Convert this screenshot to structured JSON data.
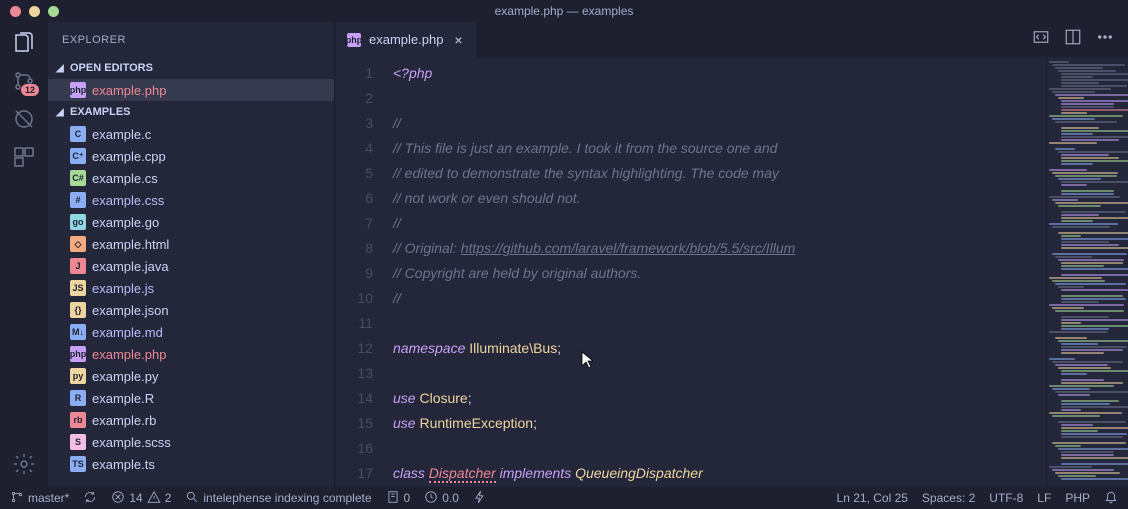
{
  "window": {
    "title": "example.php — examples"
  },
  "sidebar": {
    "title": "EXPLORER",
    "sections": {
      "open_editors": {
        "label": "OPEN EDITORS"
      },
      "examples": {
        "label": "EXAMPLES"
      }
    },
    "open_file": {
      "name": "example.php",
      "kind": "php"
    },
    "files": [
      {
        "name": "example.c",
        "kind": "c"
      },
      {
        "name": "example.cpp",
        "kind": "cpp"
      },
      {
        "name": "example.cs",
        "kind": "cs"
      },
      {
        "name": "example.css",
        "kind": "css"
      },
      {
        "name": "example.go",
        "kind": "go"
      },
      {
        "name": "example.html",
        "kind": "html"
      },
      {
        "name": "example.java",
        "kind": "java"
      },
      {
        "name": "example.js",
        "kind": "js"
      },
      {
        "name": "example.json",
        "kind": "json"
      },
      {
        "name": "example.md",
        "kind": "md"
      },
      {
        "name": "example.php",
        "kind": "php"
      },
      {
        "name": "example.py",
        "kind": "py"
      },
      {
        "name": "example.R",
        "kind": "r"
      },
      {
        "name": "example.rb",
        "kind": "rb"
      },
      {
        "name": "example.scss",
        "kind": "scss"
      },
      {
        "name": "example.ts",
        "kind": "ts"
      }
    ]
  },
  "activity": {
    "scm_badge": "12"
  },
  "tabs": {
    "active": {
      "name": "example.php",
      "kind": "php"
    }
  },
  "code": {
    "lines": [
      {
        "n": 1,
        "raw": "<?php",
        "kind": "keyword"
      },
      {
        "n": 2,
        "raw": "",
        "kind": "blank"
      },
      {
        "n": 3,
        "raw": "//",
        "kind": "comment"
      },
      {
        "n": 4,
        "raw": "// This file is just an example. I took it from the source one and",
        "kind": "comment"
      },
      {
        "n": 5,
        "raw": "// edited to demonstrate the syntax highlighting. The code may",
        "kind": "comment"
      },
      {
        "n": 6,
        "raw": "// not work or even should not.",
        "kind": "comment"
      },
      {
        "n": 7,
        "raw": "//",
        "kind": "comment"
      },
      {
        "n": 8,
        "raw": "// Original: https://github.com/laravel/framework/blob/5.5/src/Illum",
        "kind": "comment-url",
        "prefix": "// Original: ",
        "url": "https://github.com/laravel/framework/blob/5.5/src/Illum"
      },
      {
        "n": 9,
        "raw": "// Copyright are held by original authors.",
        "kind": "comment"
      },
      {
        "n": 10,
        "raw": "//",
        "kind": "comment"
      },
      {
        "n": 11,
        "raw": "",
        "kind": "blank"
      },
      {
        "n": 12,
        "raw": "namespace Illuminate\\Bus;",
        "kind": "ns",
        "kw": "namespace",
        "ns": "Illuminate\\Bus"
      },
      {
        "n": 13,
        "raw": "",
        "kind": "blank"
      },
      {
        "n": 14,
        "raw": "use Closure;",
        "kind": "use",
        "kw": "use",
        "cls": "Closure"
      },
      {
        "n": 15,
        "raw": "use RuntimeException;",
        "kind": "use",
        "kw": "use",
        "cls": "RuntimeException"
      },
      {
        "n": 16,
        "raw": "",
        "kind": "blank"
      },
      {
        "n": 17,
        "raw": "class Dispatcher implements QueueingDispatcher",
        "kind": "class",
        "kw1": "class",
        "name": "Dispatcher",
        "kw2": "implements",
        "iface": "QueueingDispatcher"
      }
    ]
  },
  "statusbar": {
    "branch": "master*",
    "errors": "14",
    "warnings": "2",
    "message": "intelephense indexing complete",
    "notebook": "0",
    "timer": "0.0",
    "position": "Ln 21, Col 25",
    "spaces": "Spaces: 2",
    "encoding": "UTF-8",
    "eol": "LF",
    "language": "PHP"
  },
  "icons": {
    "c": {
      "txt": "C",
      "bg": "#8aadf4",
      "fg": "#1e2030"
    },
    "cpp": {
      "txt": "C⁺",
      "bg": "#8aadf4",
      "fg": "#1e2030"
    },
    "cs": {
      "txt": "C#",
      "bg": "#a6da95",
      "fg": "#1e2030"
    },
    "css": {
      "txt": "#",
      "bg": "#8aadf4",
      "fg": "#1e2030"
    },
    "go": {
      "txt": "go",
      "bg": "#91d7e3",
      "fg": "#1e2030"
    },
    "html": {
      "txt": "◇",
      "bg": "#f5a97f",
      "fg": "#1e2030"
    },
    "java": {
      "txt": "J",
      "bg": "#ed8796",
      "fg": "#1e2030"
    },
    "js": {
      "txt": "JS",
      "bg": "#eed49f",
      "fg": "#1e2030"
    },
    "json": {
      "txt": "{}",
      "bg": "#eed49f",
      "fg": "#1e2030"
    },
    "md": {
      "txt": "M↓",
      "bg": "#8aadf4",
      "fg": "#1e2030"
    },
    "php": {
      "txt": "php",
      "bg": "#c6a0f6",
      "fg": "#1e2030"
    },
    "py": {
      "txt": "py",
      "bg": "#eed49f",
      "fg": "#1e2030"
    },
    "r": {
      "txt": "R",
      "bg": "#8aadf4",
      "fg": "#1e2030"
    },
    "rb": {
      "txt": "rb",
      "bg": "#ed8796",
      "fg": "#1e2030"
    },
    "scss": {
      "txt": "S",
      "bg": "#f5bde6",
      "fg": "#1e2030"
    },
    "ts": {
      "txt": "TS",
      "bg": "#8aadf4",
      "fg": "#1e2030"
    }
  }
}
